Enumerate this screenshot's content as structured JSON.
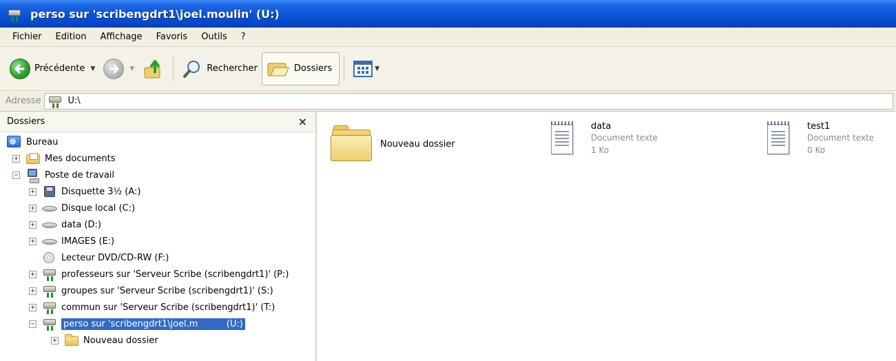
{
  "window": {
    "title": "perso sur 'scribengdrt1\\joel.moulin' (U:)"
  },
  "menu": [
    "Fichier",
    "Edition",
    "Affichage",
    "Favoris",
    "Outils",
    "?"
  ],
  "toolbar": {
    "back_label": "Précédente",
    "search_label": "Rechercher",
    "folders_label": "Dossiers"
  },
  "address": {
    "label": "Adresse",
    "value": "U:\\"
  },
  "folders_pane": {
    "title": "Dossiers",
    "tree": [
      {
        "label": "Bureau",
        "icon": "desktop-icon",
        "level": 0,
        "toggle": ""
      },
      {
        "label": "Mes documents",
        "icon": "my-documents-icon",
        "level": 1,
        "toggle": "+"
      },
      {
        "label": "Poste de travail",
        "icon": "my-computer-icon",
        "level": 1,
        "toggle": "−"
      },
      {
        "label": "Disquette 3½ (A:)",
        "icon": "floppy-drive-icon",
        "level": 2,
        "toggle": "+"
      },
      {
        "label": "Disque local (C:)",
        "icon": "hard-drive-icon",
        "level": 2,
        "toggle": "+"
      },
      {
        "label": "data (D:)",
        "icon": "hard-drive-icon",
        "level": 2,
        "toggle": "+"
      },
      {
        "label": "IMAGES (E:)",
        "icon": "hard-drive-icon",
        "level": 2,
        "toggle": "+"
      },
      {
        "label": "Lecteur DVD/CD-RW (F:)",
        "icon": "cd-drive-icon",
        "level": 2,
        "toggle": ""
      },
      {
        "label": "professeurs sur 'Serveur Scribe (scribengdrt1)' (P:)",
        "icon": "network-drive-icon",
        "level": 2,
        "toggle": "+"
      },
      {
        "label": "groupes sur 'Serveur Scribe (scribengdrt1)' (S:)",
        "icon": "network-drive-icon",
        "level": 2,
        "toggle": "+"
      },
      {
        "label": "commun sur 'Serveur Scribe (scribengdrt1)' (T:)",
        "icon": "network-drive-icon",
        "level": 2,
        "toggle": "+"
      },
      {
        "label": "perso sur 'scribengdrt1\\joel.m          (U:)",
        "icon": "network-drive-icon",
        "level": 2,
        "toggle": "−",
        "selected": true
      },
      {
        "label": "Nouveau dossier",
        "icon": "folder-icon",
        "level": 3,
        "toggle": "+"
      }
    ]
  },
  "content": {
    "items": [
      {
        "name": "Nouveau dossier",
        "type": "",
        "size": ""
      },
      {
        "name": "data",
        "type": "Document texte",
        "size": "1 Ko"
      },
      {
        "name": "test1",
        "type": "Document texte",
        "size": "0 Ko"
      }
    ]
  },
  "colors": {
    "titlebar": "#0a55da",
    "selection": "#316ac5",
    "chrome": "#f1efe2"
  }
}
